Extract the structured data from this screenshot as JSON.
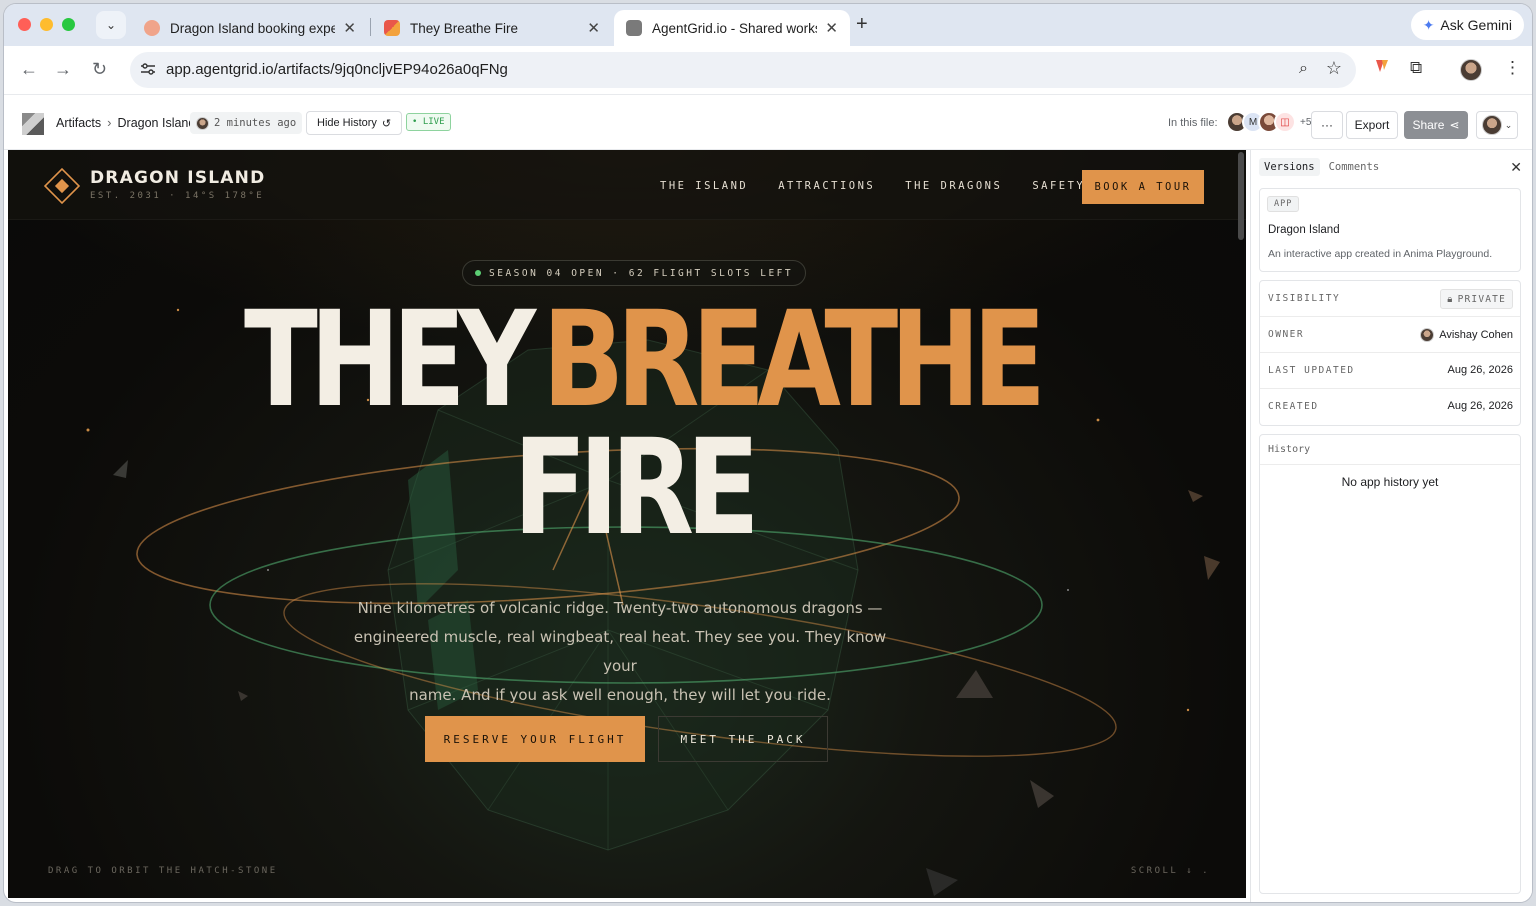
{
  "browser": {
    "tabs": [
      {
        "title": "Dragon Island booking experi",
        "favicon_color": "#e8846a"
      },
      {
        "title": "They Breathe Fire",
        "favicon_color": "#e9574a"
      },
      {
        "title": "AgentGrid.io - Shared worksp",
        "favicon_color": "#6b6b6b"
      }
    ],
    "active_tab": 2,
    "gemini_label": "Ask Gemini",
    "url": "app.agentgrid.io/artifacts/9jq0ncljvEP94o26a0qFNg"
  },
  "toolbar": {
    "breadcrumbs": [
      "Artifacts",
      "Dragon Island"
    ],
    "updated": "2 minutes ago",
    "hide_history_label": "Hide History",
    "live_label": "• LIVE",
    "in_this_file_label": "In this file:",
    "collaborator_initial": "M",
    "collaborator_more": "+5",
    "export_label": "Export",
    "share_label": "Share"
  },
  "site": {
    "brand": "DRAGON ISLAND",
    "brand_sub": "EST. 2031 · 14°S 178°E",
    "nav": [
      "THE ISLAND",
      "ATTRACTIONS",
      "THE DRAGONS",
      "SAFETY"
    ],
    "book_label": "BOOK A TOUR",
    "season_badge": "SEASON 04 OPEN · 62 FLIGHT SLOTS LEFT",
    "headline_1": "THEY",
    "headline_2": "BREATHE",
    "headline_3": "FIRE",
    "copy_line_1": "Nine kilometres of volcanic ridge. Twenty-two autonomous dragons —",
    "copy_line_2": "engineered muscle, real wingbeat, real heat. They see you. They know your",
    "copy_line_3": "name. And if you ask well enough, they will let you ride.",
    "cta_primary": "RESERVE YOUR FLIGHT",
    "cta_secondary": "MEET THE PACK",
    "drag_hint": "DRAG TO ORBIT THE HATCH-STONE",
    "scroll_hint": "SCROLL ↓ ."
  },
  "panel": {
    "tabs": [
      "Versions",
      "Comments"
    ],
    "app_tag": "APP",
    "app_name": "Dragon Island",
    "app_desc": "An interactive app created in Anima Playground.",
    "meta": [
      {
        "key": "VISIBILITY",
        "value": "PRIVATE"
      },
      {
        "key": "OWNER",
        "value": "Avishay Cohen"
      },
      {
        "key": "LAST UPDATED",
        "value": "Aug 26, 2026"
      },
      {
        "key": "CREATED",
        "value": "Aug 26, 2026"
      }
    ],
    "history_title": "History",
    "history_empty": "No app history yet"
  },
  "colors": {
    "accent_orange": "#e0944b",
    "headline_cream": "#f3eee4",
    "live_green": "#2e9d4d"
  }
}
